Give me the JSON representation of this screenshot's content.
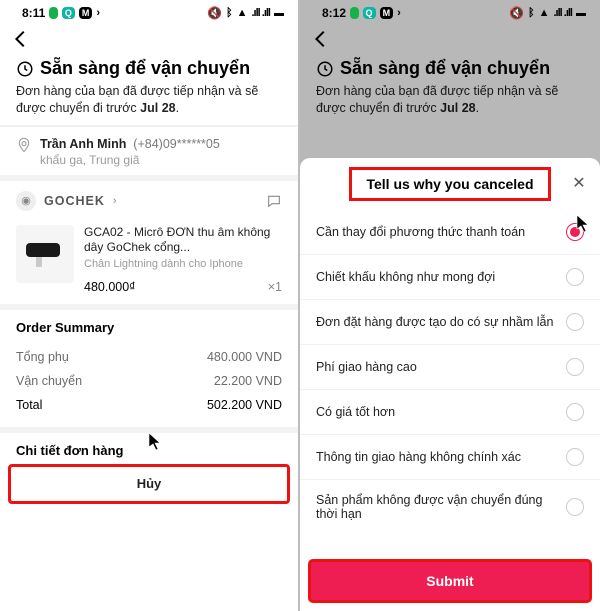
{
  "left": {
    "status": {
      "time": "8:11",
      "signal": "📶 .ıll .ıll",
      "icons": [
        "",
        "Q",
        "M"
      ]
    },
    "header": {
      "title": "Sẵn sàng để vận chuyển",
      "sub_prefix": "Đơn hàng của bạn đã được tiếp nhận và sẽ được chuyển đi trước ",
      "sub_bold": "Jul 28",
      "sub_suffix": "."
    },
    "address": {
      "name": "Trần Anh Minh",
      "phone": "(+84)09******05",
      "line2": "khẩu ga, Trung giã"
    },
    "shop": {
      "name": "GOCHEK"
    },
    "product": {
      "title": "GCA02 - Micrô ĐƠN thu âm không dây GoChek cổng...",
      "subtitle": "Chân Lightning dành cho Iphone",
      "price": "480.000₫",
      "qty": "×1"
    },
    "summary": {
      "title": "Order Summary",
      "rows": [
        {
          "label": "Tổng phụ",
          "value": "480.000 VND"
        },
        {
          "label": "Vận chuyển",
          "value": "22.200 VND"
        },
        {
          "label": "Total",
          "value": "502.200 VND"
        }
      ]
    },
    "details_title": "Chi tiết đơn hàng",
    "cancel_label": "Hủy"
  },
  "right": {
    "status": {
      "time": "8:12"
    },
    "header": {
      "title": "Sẵn sàng để vận chuyển",
      "sub_prefix": "Đơn hàng của bạn đã được tiếp nhận và sẽ được chuyển đi trước ",
      "sub_bold": "Jul 28",
      "sub_suffix": "."
    },
    "sheet": {
      "title": "Tell us why you canceled",
      "reasons": [
        "Cần thay đổi phương thức thanh toán",
        "Chiết khấu không như mong đợi",
        "Đơn đặt hàng được tạo do có sự nhầm lẫn",
        "Phí giao hàng cao",
        "Có giá tốt hơn",
        "Thông tin giao hàng không chính xác",
        "Sản phẩm không được vận chuyển đúng thời hạn"
      ],
      "selected_index": 0,
      "submit_label": "Submit"
    }
  }
}
